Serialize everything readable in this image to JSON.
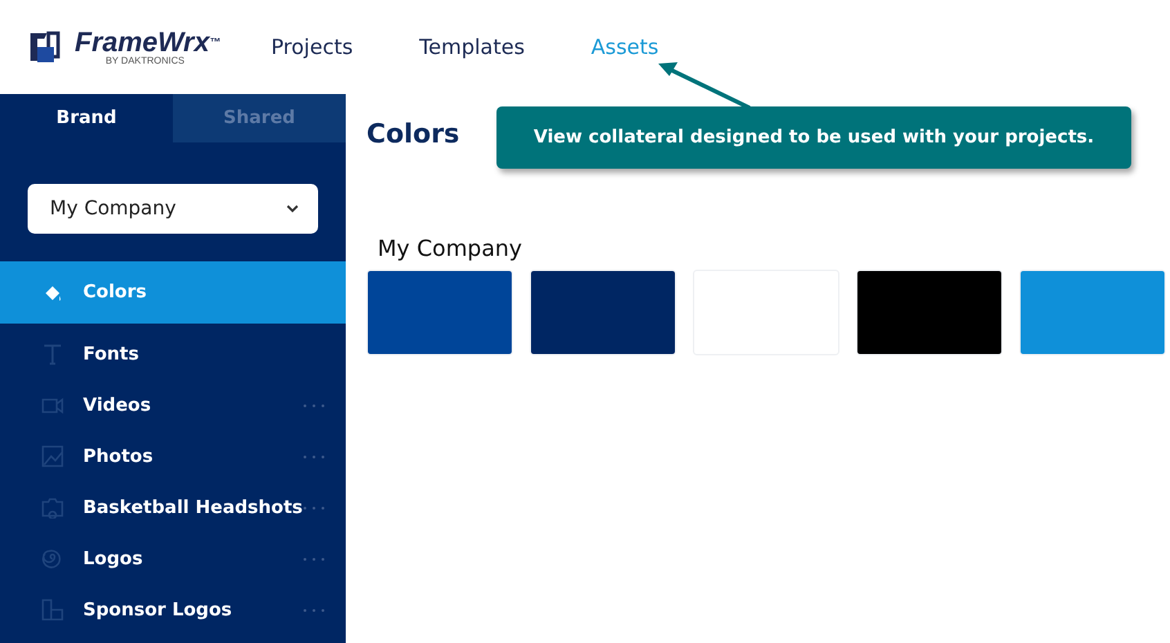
{
  "header": {
    "logo": {
      "name": "FrameWrx",
      "trademark": "™",
      "byline": "BY DAKTRONICS"
    },
    "nav": [
      {
        "label": "Projects",
        "selected": false
      },
      {
        "label": "Templates",
        "selected": false
      },
      {
        "label": "Assets",
        "selected": true
      }
    ]
  },
  "sidebar": {
    "tabs": [
      {
        "label": "Brand",
        "selected": true
      },
      {
        "label": "Shared",
        "selected": false
      }
    ],
    "dropdown": {
      "value": "My Company"
    },
    "items": [
      {
        "label": "Colors",
        "selected": true,
        "has_menu": false
      },
      {
        "label": "Fonts",
        "selected": false,
        "has_menu": false
      },
      {
        "label": "Videos",
        "selected": false,
        "has_menu": true
      },
      {
        "label": "Photos",
        "selected": false,
        "has_menu": true
      },
      {
        "label": "Basketball Headshots",
        "selected": false,
        "has_menu": true
      },
      {
        "label": "Logos",
        "selected": false,
        "has_menu": true
      },
      {
        "label": "Sponsor Logos",
        "selected": false,
        "has_menu": true
      }
    ]
  },
  "main": {
    "title": "Colors",
    "group": "My Company",
    "swatches": [
      {
        "color": "#004599"
      },
      {
        "color": "#002663"
      },
      {
        "color": "#ffffff"
      },
      {
        "color": "#000000"
      },
      {
        "color": "#0f90d9"
      }
    ]
  },
  "callout": {
    "text": "View collateral designed to be used with your projects."
  }
}
